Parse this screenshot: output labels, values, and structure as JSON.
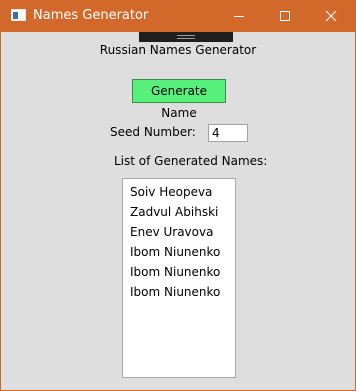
{
  "window": {
    "title": "Names Generator",
    "title_color": "#d2692a",
    "icons": {
      "app": "window-app-icon",
      "minimize": "minimize-icon",
      "maximize": "maximize-icon",
      "close": "close-icon"
    }
  },
  "main": {
    "heading": "Russian Names Generator",
    "generate_button_label": "Generate Name",
    "generate_button_color": "#57f07a",
    "seed_label": "Seed Number:",
    "seed_value": "4",
    "list_label": "List of Generated Names:",
    "generated_names": [
      "Soiv Heopeva",
      "Zadvul Abihski",
      "Enev Uravova",
      "Ibom Niunenko",
      "Ibom Niunenko",
      "Ibom Niunenko"
    ]
  }
}
